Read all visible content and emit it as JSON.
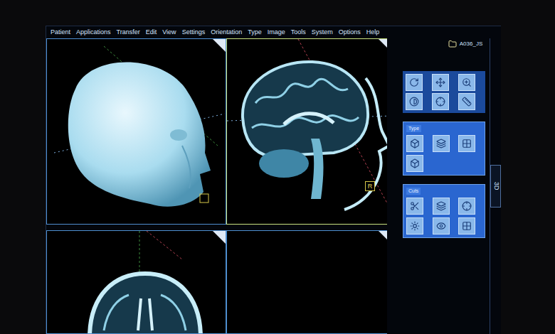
{
  "menu": [
    "Patient",
    "Applications",
    "Transfer",
    "Edit",
    "View",
    "Settings",
    "Orientation",
    "Type",
    "Image",
    "Tools",
    "System",
    "Options",
    "Help"
  ],
  "patient": {
    "folder": "A036_JS"
  },
  "viewports": [
    {
      "kind": "volume",
      "selected": false,
      "marker": ""
    },
    {
      "kind": "sagittal",
      "selected": true,
      "marker": "R"
    },
    {
      "kind": "axial",
      "selected": false,
      "marker": ""
    },
    {
      "kind": "empty",
      "selected": false,
      "marker": ""
    }
  ],
  "panel_groups": [
    {
      "label": "Type"
    },
    {
      "label": "Cuts"
    }
  ],
  "side_tab": "3D"
}
